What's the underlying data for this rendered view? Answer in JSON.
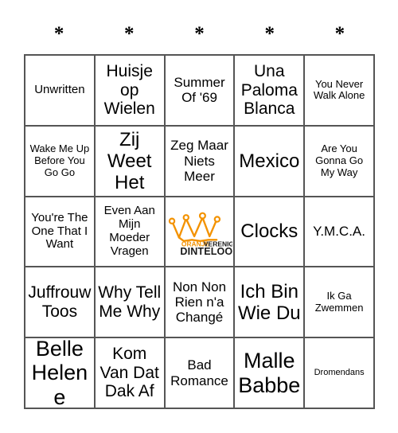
{
  "card": {
    "header_marks": [
      "*",
      "*",
      "*",
      "*",
      "*"
    ],
    "colors": {
      "border": "#555555",
      "background": "#ffffff",
      "text": "#000000",
      "logo_orange": "#F39200",
      "logo_black": "#1A1A1A"
    },
    "rows": [
      [
        {
          "text": "Unwritten",
          "size": "fs-m"
        },
        {
          "text": "Huisje op Wielen",
          "size": "fs-xl"
        },
        {
          "text": "Summer Of '69",
          "size": "fs-l"
        },
        {
          "text": "Una Paloma Blanca",
          "size": "fs-xl"
        },
        {
          "text": "You Never Walk Alone",
          "size": "fs-s"
        }
      ],
      [
        {
          "text": "Wake Me Up Before You Go Go",
          "size": "fs-s"
        },
        {
          "text": "Zij Weet Het",
          "size": "fs-xxl"
        },
        {
          "text": "Zeg Maar Niets Meer",
          "size": "fs-l"
        },
        {
          "text": "Mexico",
          "size": "fs-xxl"
        },
        {
          "text": "Are You Gonna Go My Way",
          "size": "fs-s"
        }
      ],
      [
        {
          "text": "You're The One That I Want",
          "size": "fs-m"
        },
        {
          "text": "Even Aan Mijn Moeder Vragen",
          "size": "fs-m"
        },
        {
          "text": "",
          "size": "logo"
        },
        {
          "text": "Clocks",
          "size": "fs-xxl"
        },
        {
          "text": "Y.M.C.A.",
          "size": "fs-l"
        }
      ],
      [
        {
          "text": "Juffrouw Toos",
          "size": "fs-xl"
        },
        {
          "text": "Why Tell Me Why",
          "size": "fs-xl"
        },
        {
          "text": "Non Non Rien n'a Changé",
          "size": "fs-l"
        },
        {
          "text": "Ich Bin Wie Du",
          "size": "fs-xxl"
        },
        {
          "text": "Ik Ga Zwemmen",
          "size": "fs-s"
        }
      ],
      [
        {
          "text": "Belle Helene",
          "size": "fs-huge"
        },
        {
          "text": "Kom Van Dat Dak Af",
          "size": "fs-xl"
        },
        {
          "text": "Bad Romance",
          "size": "fs-l"
        },
        {
          "text": "Malle Babbe",
          "size": "fs-huge"
        },
        {
          "text": "Dromendans",
          "size": "fs-xs"
        }
      ]
    ],
    "logo": {
      "line1_orange": "ORANJE",
      "line1_black": "VERENIGING",
      "line2": "DINTELOORD",
      "icon": "crown-icon"
    }
  }
}
